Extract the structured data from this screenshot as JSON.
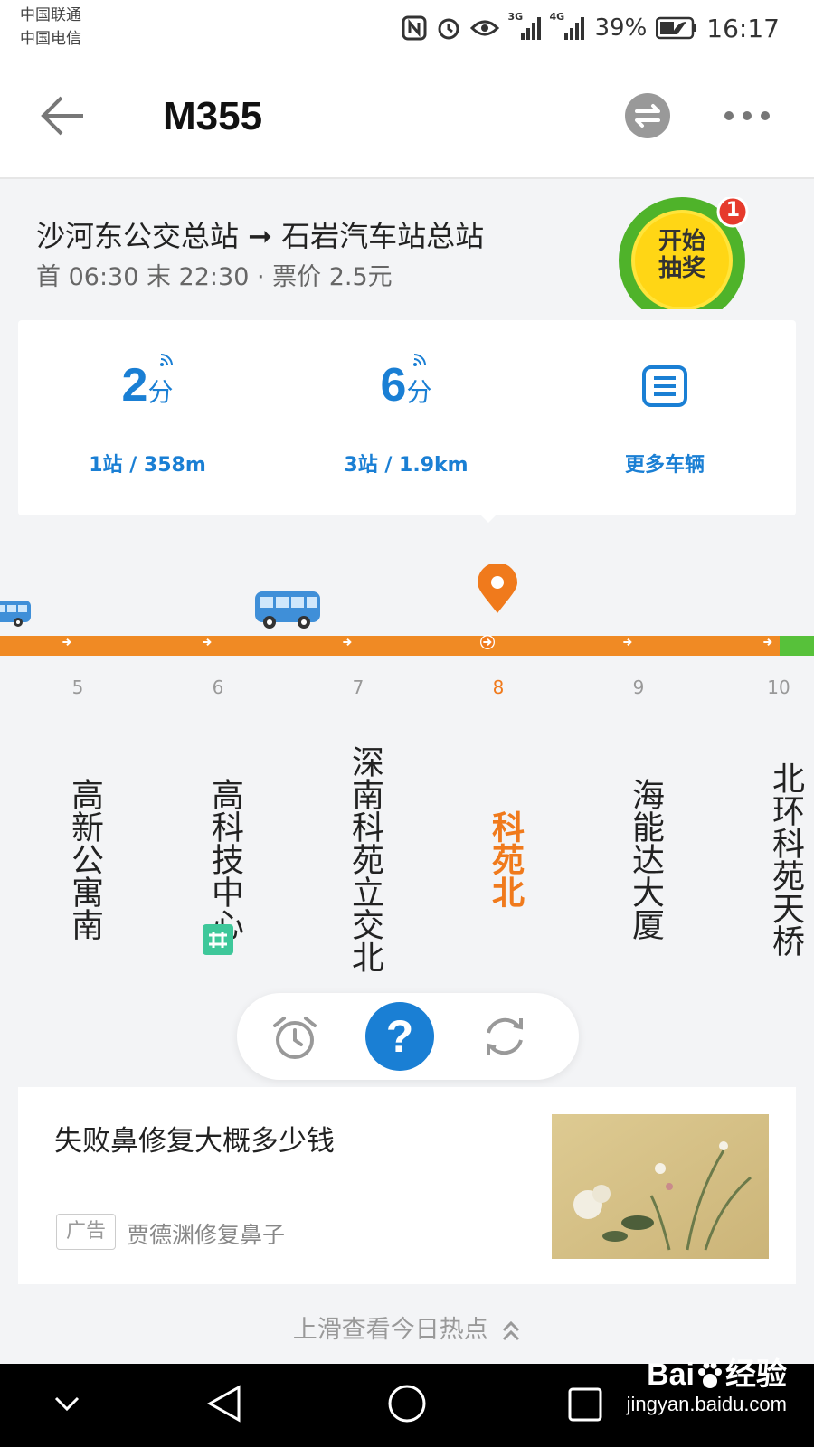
{
  "status_bar": {
    "carrier_1": "中国联通",
    "carrier_2": "中国电信",
    "network_1": "3G",
    "network_2": "4G",
    "battery": "39%",
    "time": "16:17"
  },
  "header": {
    "title": "M355",
    "back_icon": "back-arrow-icon",
    "switch_icon": "swap-direction-icon",
    "more_icon": "more-dots-icon"
  },
  "route": {
    "direction": "沙河东公交总站 ➞ 石岩汽车站总站",
    "hours": "首 06:30 末 22:30 · 票价 2.5元"
  },
  "lottery": {
    "label_line1": "开始",
    "label_line2": "抽奖",
    "badge": "1"
  },
  "eta": [
    {
      "value": "2",
      "unit": "分",
      "detail": "1站 / 358m"
    },
    {
      "value": "6",
      "unit": "分",
      "detail": "3站 / 1.9km"
    },
    {
      "label": "更多车辆",
      "icon": "list-icon"
    }
  ],
  "stops": [
    {
      "num": "5",
      "name": "高新公寓南"
    },
    {
      "num": "6",
      "name": "高科技中心"
    },
    {
      "num": "7",
      "name": "深南科苑立交北"
    },
    {
      "num": "8",
      "name": "科苑北"
    },
    {
      "num": "9",
      "name": "海能达大厦"
    },
    {
      "num": "10",
      "name": "北环科苑天桥"
    }
  ],
  "active_stop_num": "8",
  "colors": {
    "accent_blue": "#1a7fd4",
    "line_orange": "#f08a24",
    "line_green": "#57c13a",
    "active_orange": "#f07a1c",
    "metro_green": "#3ec79a"
  },
  "actions": {
    "alarm_icon": "alarm-clock-icon",
    "help_icon": "help-question-icon",
    "refresh_icon": "refresh-icon",
    "help_glyph": "?"
  },
  "ad": {
    "title": "失败鼻修复大概多少钱",
    "tag": "广告",
    "source": "贾德渊修复鼻子"
  },
  "swipe_hint": "上滑查看今日热点",
  "watermark": {
    "brand": "Bai",
    "brand_suffix": "经验",
    "url": "jingyan.baidu.com"
  }
}
